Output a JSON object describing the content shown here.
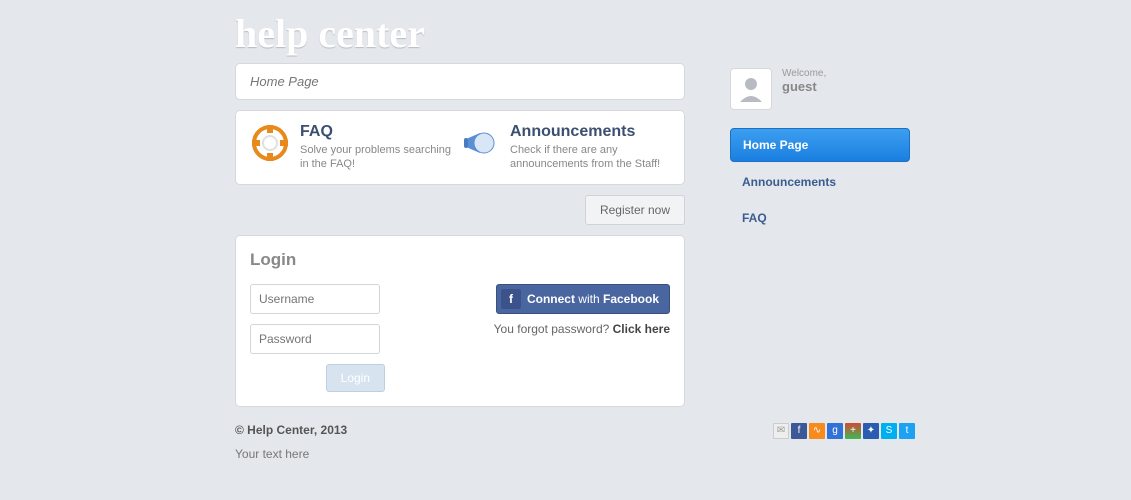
{
  "site": {
    "title": "help center"
  },
  "breadcrumb": "Home Page",
  "tiles": {
    "faq": {
      "title": "FAQ",
      "desc": "Solve your problems searching in the FAQ!"
    },
    "ann": {
      "title": "Announcements",
      "desc": "Check if there are any announcements from the Staff!"
    }
  },
  "register_label": "Register now",
  "login": {
    "title": "Login",
    "username_ph": "Username",
    "password_ph": "Password",
    "submit": "Login",
    "fb_prefix": "Connect",
    "fb_mid": " with ",
    "fb_brand": "Facebook",
    "forgot_text": "You forgot password? ",
    "forgot_link": "Click here"
  },
  "user": {
    "welcome": "Welcome,",
    "name": "guest"
  },
  "nav": {
    "home": "Home Page",
    "ann": "Announcements",
    "faq": "FAQ"
  },
  "footer": {
    "copyright": "© Help Center, 2013",
    "text": "Your text here"
  }
}
